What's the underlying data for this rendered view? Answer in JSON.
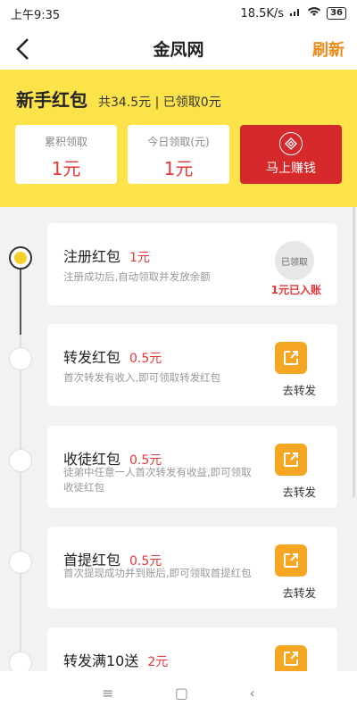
{
  "status": {
    "time": "上午9:35",
    "network": "18.5K/s",
    "battery": "36"
  },
  "nav": {
    "title": "金凤网",
    "refresh": "刷新"
  },
  "banner": {
    "title": "新手红包",
    "summary": "共34.5元 | 已领取0元",
    "stats": [
      {
        "label": "累积领取",
        "value": "1元"
      },
      {
        "label": "今日领取(元)",
        "value": "1元"
      }
    ],
    "earn_label": "马上赚钱"
  },
  "tasks": [
    {
      "title": "注册红包",
      "amount": "1元",
      "desc": "注册成功后,自动领取并发放余额",
      "badge": "已领取",
      "status": "1元已入账"
    },
    {
      "title": "转发红包",
      "amount": "0.5元",
      "desc": "首次转发有收入,即可领取转发红包",
      "action": "去转发"
    },
    {
      "title": "收徒红包",
      "amount": "0.5元",
      "desc": "徒弟中任意一人首次转发有收益,即可领取收徒红包",
      "action": "去转发"
    },
    {
      "title": "首提红包",
      "amount": "0.5元",
      "desc": "首次提现成功并到账后,即可领取首提红包",
      "action": "去转发"
    },
    {
      "title": "转发满10送",
      "amount": "2元"
    }
  ],
  "system_nav": {
    "menu": "≡",
    "home": "▢",
    "back": "‹"
  },
  "colors": {
    "accent": "#f08a18",
    "banner_bg": "#fde34a",
    "earn_bg": "#d6292b",
    "amount_red": "#e33838",
    "share_btn": "#f5a623"
  }
}
